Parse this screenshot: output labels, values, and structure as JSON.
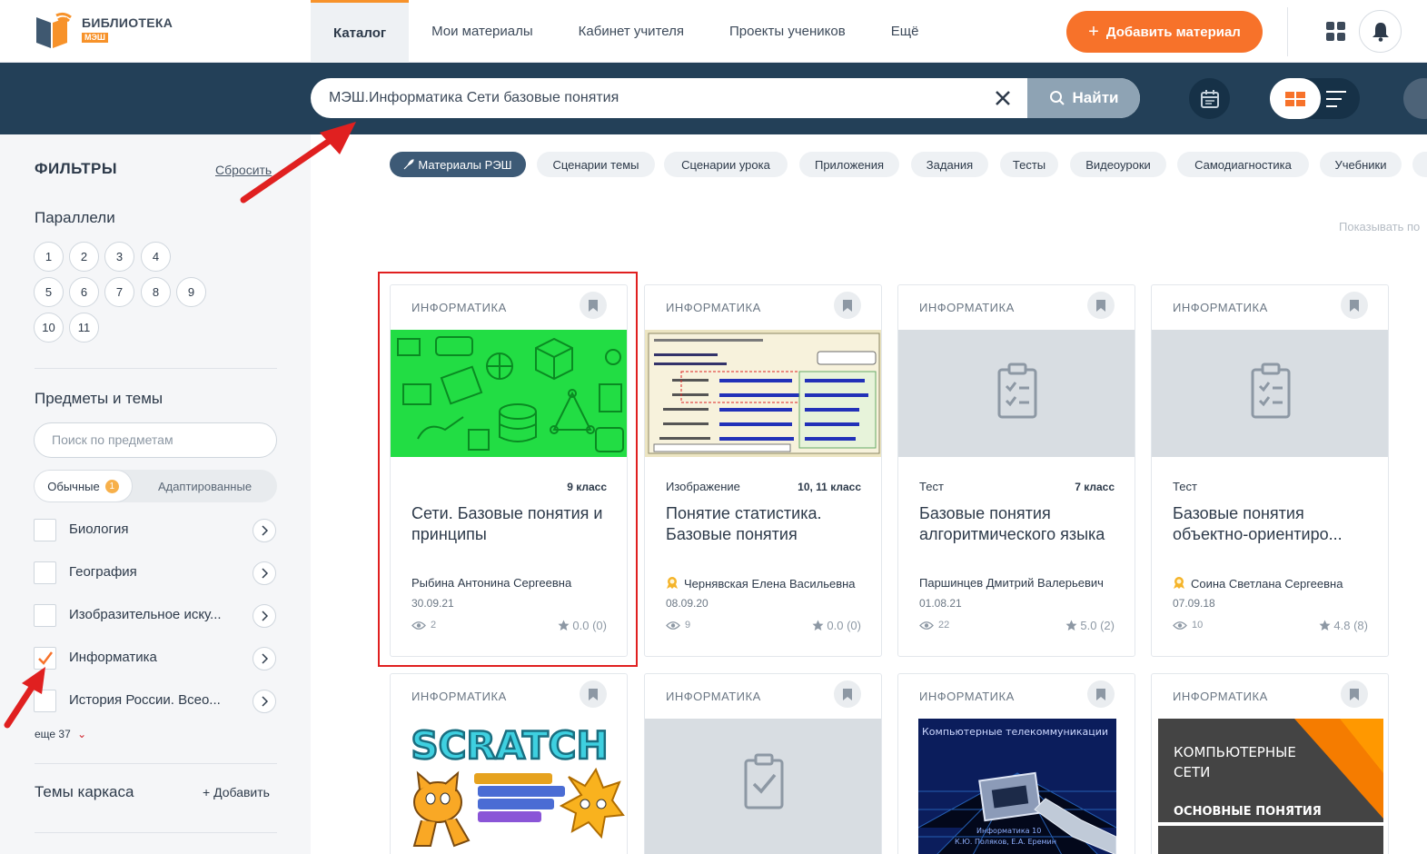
{
  "header": {
    "logo_title": "БИБЛИОТЕКА",
    "logo_sub": "МЭШ",
    "nav": [
      "Каталог",
      "Мои материалы",
      "Кабинет учителя",
      "Проекты учеников",
      "Ещё"
    ],
    "active_nav": "Каталог",
    "add_button": "Добавить материал",
    "add_plus": "+"
  },
  "search": {
    "value": "МЭШ.Информатика Сети базовые понятия",
    "button": "Найти"
  },
  "sidebar": {
    "title": "ФИЛЬТРЫ",
    "reset": "Сбросить",
    "grades_title": "Параллели",
    "grades": [
      "1",
      "2",
      "3",
      "4",
      "5",
      "6",
      "7",
      "8",
      "9",
      "10",
      "11"
    ],
    "subjects_title": "Предметы и темы",
    "subject_search_placeholder": "Поиск по предметам",
    "segment_regular": "Обычные",
    "segment_badge": "1",
    "segment_adapted": "Адаптированные",
    "subjects": [
      {
        "label": "Биология",
        "checked": false
      },
      {
        "label": "География",
        "checked": false
      },
      {
        "label": "Изобразительное иску...",
        "checked": false
      },
      {
        "label": "Информатика",
        "checked": true
      },
      {
        "label": "История России. Всео...",
        "checked": false
      }
    ],
    "more": "еще 37",
    "frame_title": "Темы каркаса",
    "frame_add": "+ Добавить"
  },
  "chips": [
    {
      "label": "Материалы РЭШ",
      "active": true
    },
    {
      "label": "Сценарии темы",
      "active": false
    },
    {
      "label": "Сценарии урока",
      "active": false
    },
    {
      "label": "Приложения",
      "active": false
    },
    {
      "label": "Задания",
      "active": false
    },
    {
      "label": "Тесты",
      "active": false
    },
    {
      "label": "Видеоуроки",
      "active": false
    },
    {
      "label": "Самодиагностика",
      "active": false
    },
    {
      "label": "Учебники",
      "active": false
    }
  ],
  "show_by": "Показывать по",
  "cards": [
    {
      "subject": "ИНФОРМАТИКА",
      "type": "",
      "grade": "9 класс",
      "title": "Сети. Базовые понятия и принципы",
      "author": "Рыбина Антонина Сергеевна",
      "medal": false,
      "date": "30.09.21",
      "views": "2",
      "rating": "0.0 (0)",
      "image": "green-pattern"
    },
    {
      "subject": "ИНФОРМАТИКА",
      "type": "Изображение",
      "grade": "10, 11 класс",
      "title": "Понятие статистика. Базовые понятия",
      "author": "Чернявская Елена Васильевна",
      "medal": true,
      "date": "08.09.20",
      "views": "9",
      "rating": "0.0 (0)",
      "image": "spreadsheet"
    },
    {
      "subject": "ИНФОРМАТИКА",
      "type": "Тест",
      "grade": "7 класс",
      "title": "Базовые понятия алгоритмического языка",
      "author": "Паршинцев Дмитрий Валерьевич",
      "medal": false,
      "date": "01.08.21",
      "views": "22",
      "rating": "5.0 (2)",
      "image": "clipboard-list"
    },
    {
      "subject": "ИНФОРМАТИКА",
      "type": "Тест",
      "grade": "",
      "title": "Базовые понятия объектно-ориентиро...",
      "author": "Соина Светлана Сергеевна",
      "medal": true,
      "date": "07.09.18",
      "views": "10",
      "rating": "4.8 (8)",
      "image": "clipboard-list"
    },
    {
      "subject": "ИНФОРМАТИКА",
      "image": "scratch",
      "image_text": "SCRATCH"
    },
    {
      "subject": "ИНФОРМАТИКА",
      "image": "clipboard-check"
    },
    {
      "subject": "ИНФОРМАТИКА",
      "image": "network-cable",
      "image_text": "Компьютерные телекоммуникации",
      "image_caption": "Информатика 10\nК.Ю. Поляков, Е.А. Еремин"
    },
    {
      "subject": "ИНФОРМАТИКА",
      "image": "slide",
      "image_text": "КОМПЬЮТЕРНЫЕ СЕТИ",
      "image_sub": "ОСНОВНЫЕ ПОНЯТИЯ"
    }
  ],
  "colors": {
    "accent": "#f7722a",
    "band": "#234058",
    "highlight": "#e02020",
    "chip_active": "#3d5a76"
  }
}
